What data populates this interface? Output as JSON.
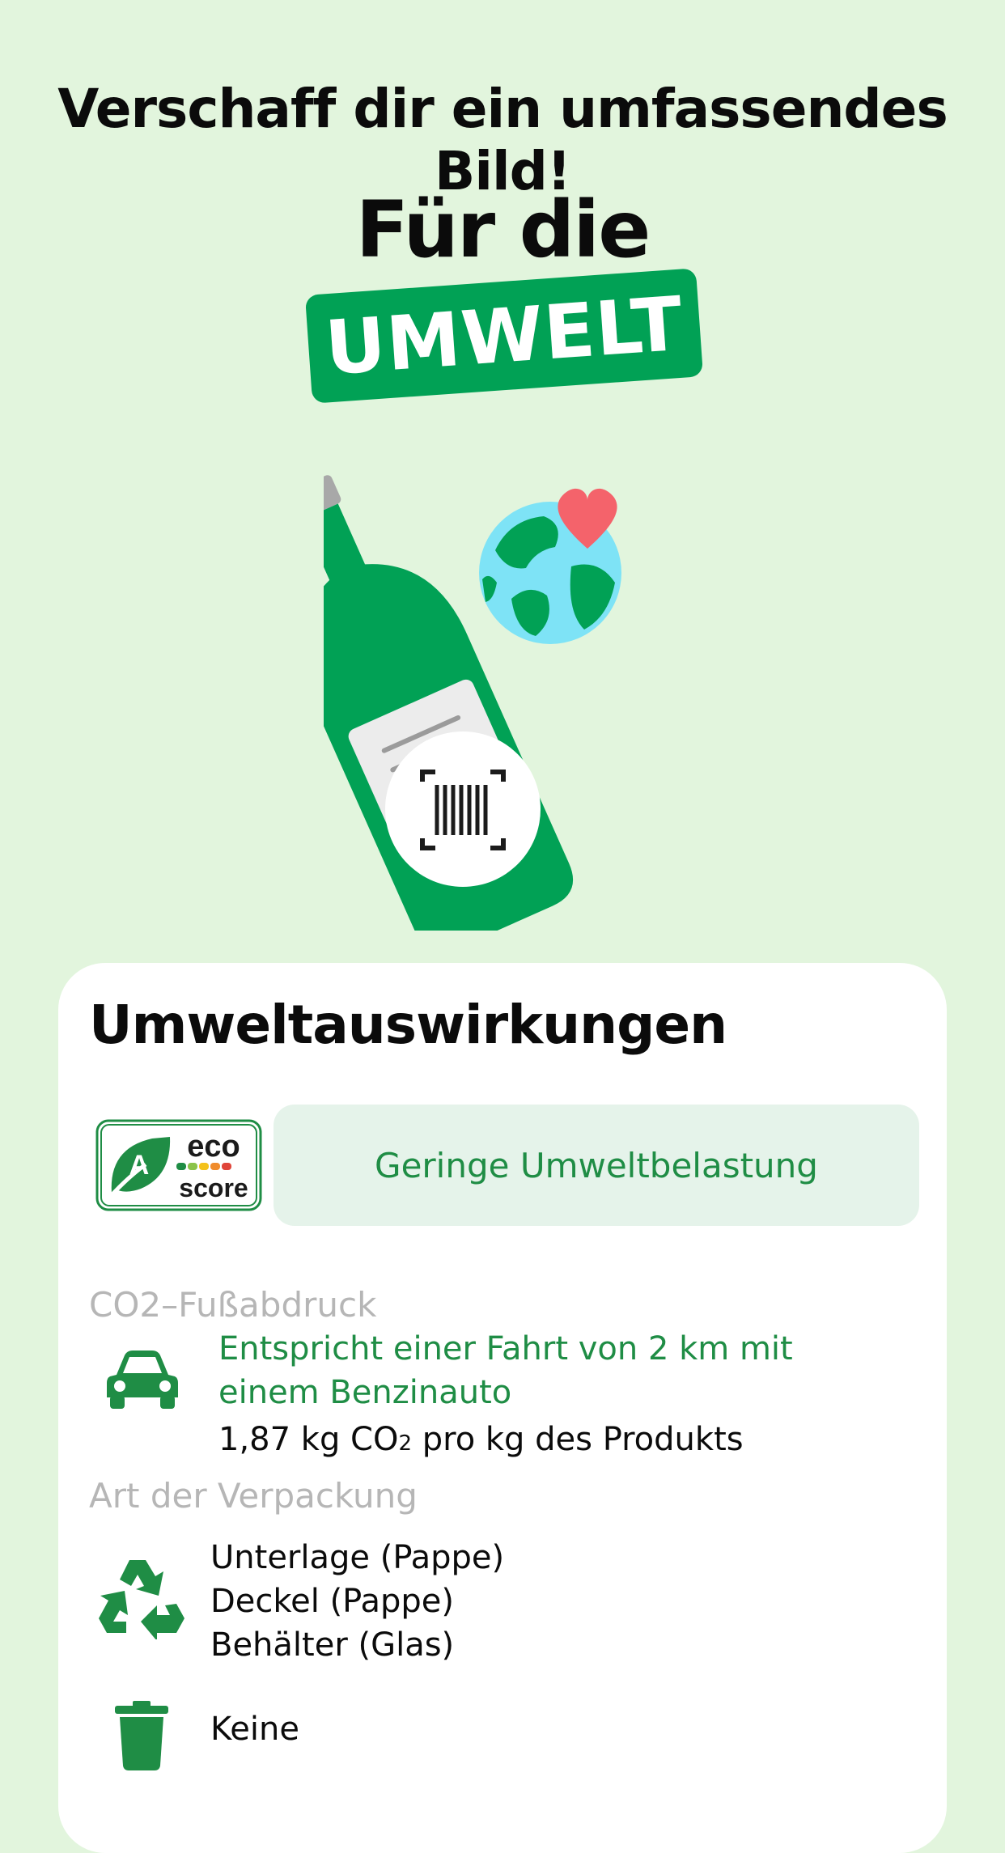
{
  "headline": "Verschaff dir ein umfassendes Bild!",
  "subhead": "Für die",
  "badge": "UMWELT",
  "card": {
    "title": "Umweltauswirkungen",
    "ecoscore": {
      "grade": "A",
      "logo_top": "eco",
      "logo_bottom": "score",
      "rating_text": "Geringe Umweltbelastung"
    },
    "co2": {
      "label": "CO2–Fußabdruck",
      "equivalent": "Entspricht einer Fahrt von 2 km mit einem Benzinauto",
      "amount_prefix": "1,87 kg CO",
      "amount_sub": "2",
      "amount_suffix": " pro kg des Produkts",
      "icon": "car-icon"
    },
    "packaging": {
      "label": "Art der Verpackung",
      "recyclable": [
        "Unterlage (Pappe)",
        "Deckel (Pappe)",
        "Behälter (Glas)"
      ],
      "recyclable_icon": "recycle-icon",
      "non_recyclable": "Keine",
      "non_recyclable_icon": "trash-icon"
    }
  },
  "colors": {
    "background": "#e2f5dd",
    "brand_green": "#01a155",
    "text_green": "#1f8d45",
    "pill_bg": "#e5f3ea",
    "muted": "#b6b6b6"
  }
}
